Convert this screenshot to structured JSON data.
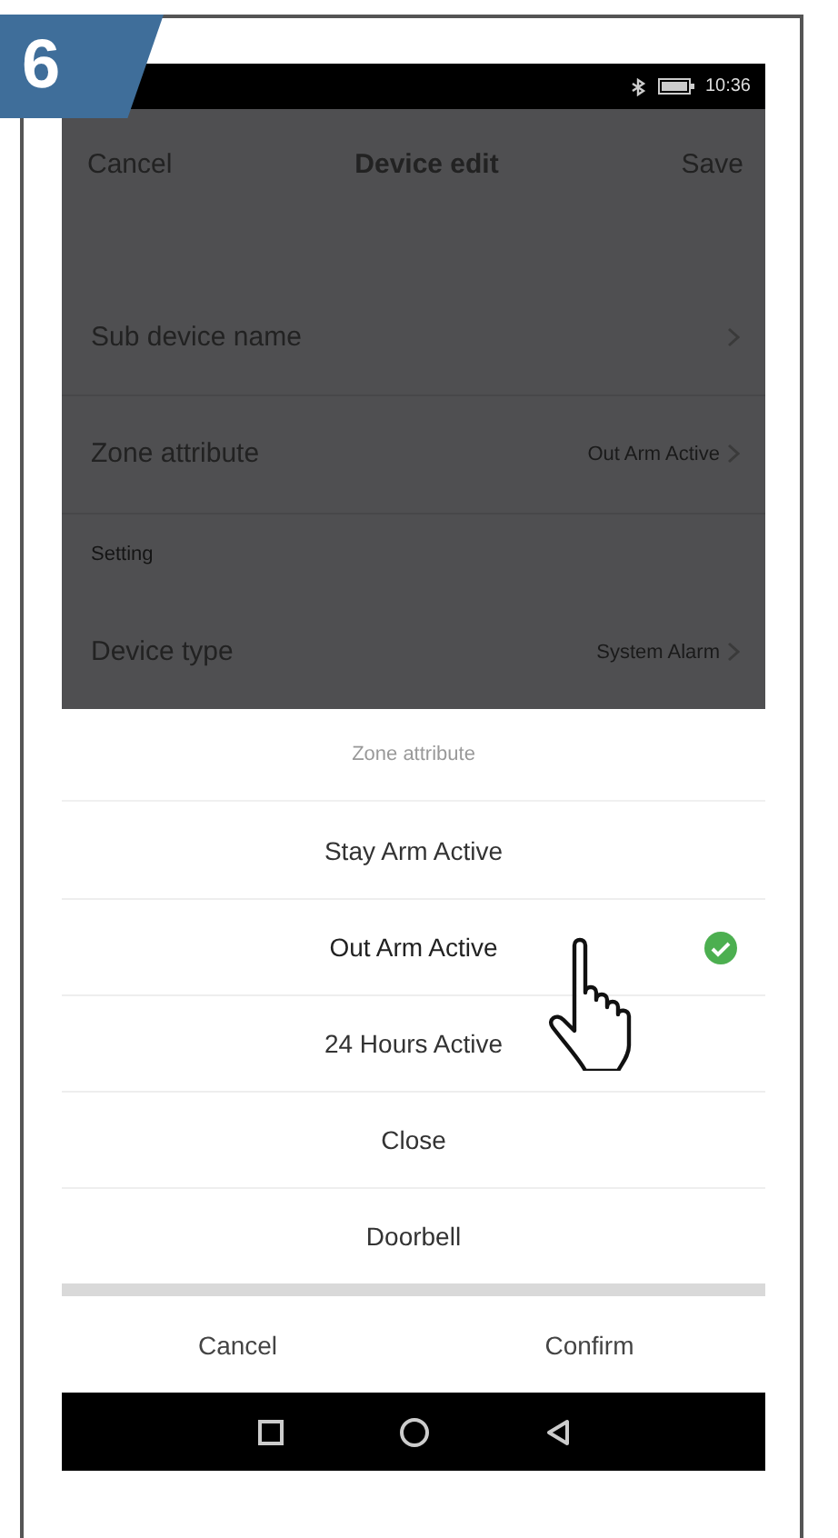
{
  "step": "6",
  "status_bar": {
    "time": "10:36"
  },
  "header": {
    "left": "Cancel",
    "title": "Device edit",
    "right": "Save"
  },
  "settings": [
    {
      "kind": "row",
      "label": "Sub device name"
    },
    {
      "kind": "row",
      "label": "Zone attribute",
      "value": "Out Arm Active"
    },
    {
      "kind": "section",
      "label": "Setting"
    },
    {
      "kind": "row",
      "label": "Device type",
      "value": "System Alarm"
    }
  ],
  "picker": {
    "title": "Zone attribute",
    "options": [
      {
        "label": "Stay Arm Active",
        "selected": false
      },
      {
        "label": "Out Arm Active",
        "selected": true
      },
      {
        "label": "24 Hours Active",
        "selected": false
      },
      {
        "label": "Close",
        "selected": false
      },
      {
        "label": "Doorbell",
        "selected": false
      }
    ],
    "buttons": [
      "Cancel",
      "Confirm"
    ]
  }
}
